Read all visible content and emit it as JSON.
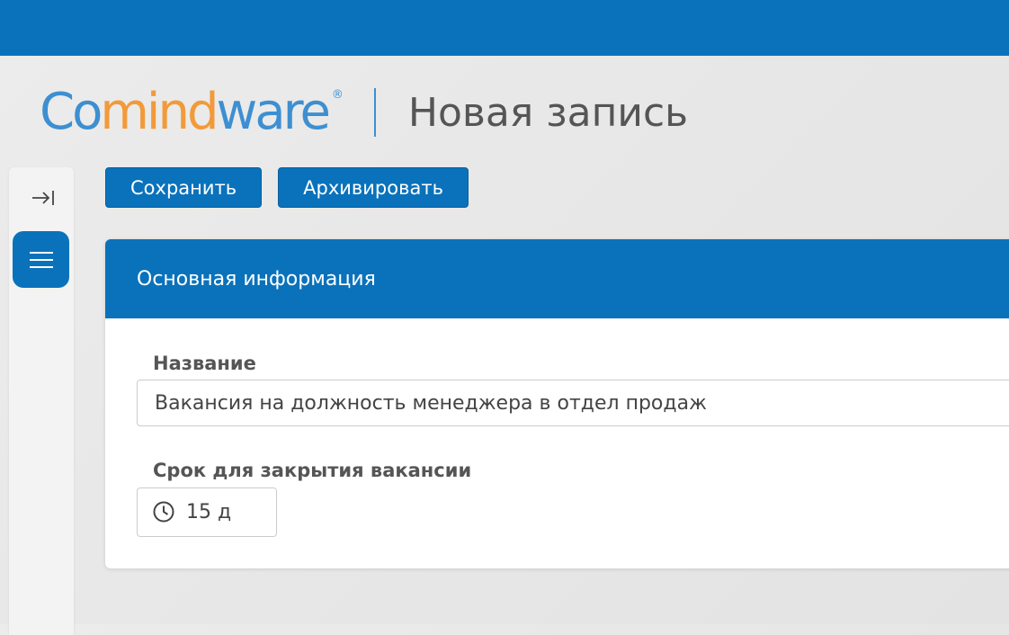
{
  "app": {
    "logo": {
      "part1": "Co",
      "part2": "mind",
      "part3": "ware",
      "reg": "®"
    },
    "page_title": "Новая запись"
  },
  "sidebar": {
    "collapse_icon": "collapse-right-icon",
    "menu_icon": "hamburger-menu-icon"
  },
  "toolbar": {
    "save_label": "Сохранить",
    "archive_label": "Архивировать"
  },
  "form": {
    "section_title": "Основная информация",
    "name_label": "Название",
    "name_value": "Вакансия на должность менеджера в отдел продаж",
    "deadline_label": "Срок для закрытия вакансии",
    "deadline_icon": "clock-icon",
    "deadline_value": "15 д"
  },
  "colors": {
    "primary": "#0a72bb",
    "logo_blue": "#3d8fd1",
    "logo_orange": "#f29a3a"
  }
}
